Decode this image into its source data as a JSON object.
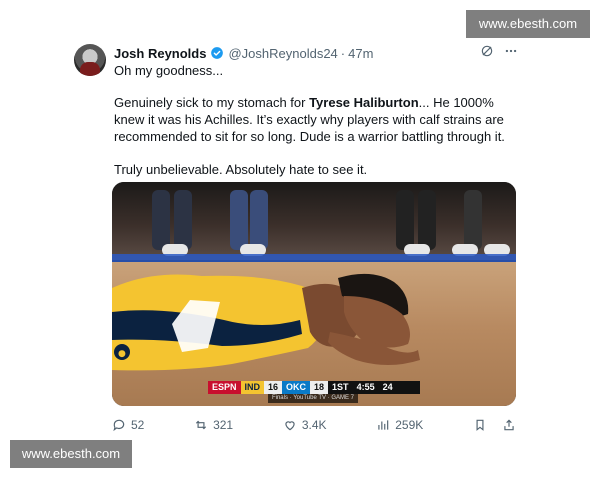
{
  "tweet": {
    "author": {
      "name": "Josh Reynolds",
      "handle": "@JoshReynolds24",
      "time": "47m",
      "verified": true
    },
    "intro": "Oh my goodness...",
    "body": {
      "p1_pre": "Genuinely sick to my stomach for ",
      "p1_bold": "Tyrese Haliburton",
      "p1_post": "... He 1000% knew it was his Achilles. It’s exactly why players with calf strains are recommended to sit for so long. Dude is a warrior battling through it.",
      "p2": "Truly unbelievable. Absolutely hate to see it."
    },
    "media": {
      "scoreboard": {
        "network": "ESPN",
        "team1": "IND",
        "score1": "16",
        "team2": "OKC",
        "score2": "18",
        "quarter": "1ST",
        "clock": "4:55",
        "shot_clock": "24"
      },
      "subscore": "Finals · YouTube TV · GAME 7"
    },
    "stats": {
      "replies": "52",
      "reposts": "321",
      "likes": "3.4K",
      "views": "259K"
    }
  },
  "watermark": {
    "top": "www.ebesth.com",
    "bottom": "www.ebesth.com"
  },
  "colors": {
    "text": "#0f1419",
    "muted": "#536471",
    "verified": "#1d9bf0",
    "ind_yellow": "#f4c430",
    "ind_navy": "#0b2240"
  }
}
